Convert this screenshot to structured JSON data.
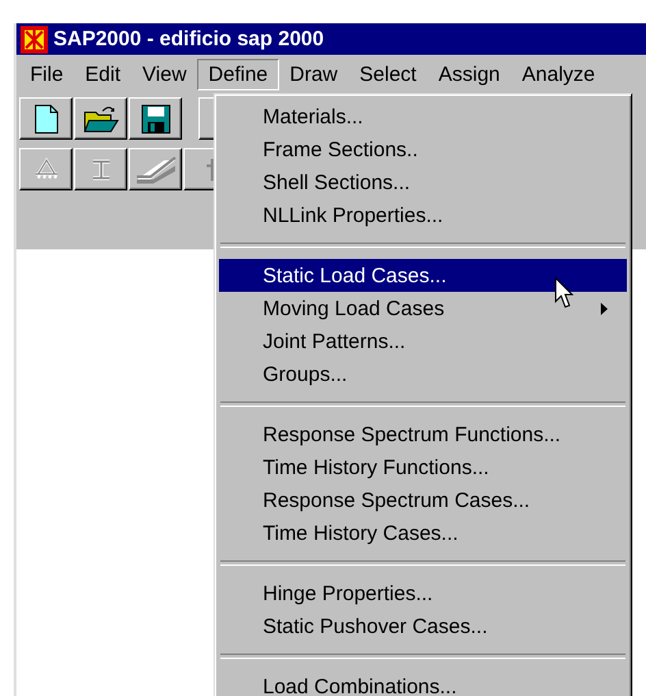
{
  "window": {
    "title": "SAP2000 - edificio sap 2000"
  },
  "menu_bar": [
    {
      "label": "File",
      "selected": false
    },
    {
      "label": "Edit",
      "selected": false
    },
    {
      "label": "View",
      "selected": false
    },
    {
      "label": "Define",
      "selected": true
    },
    {
      "label": "Draw",
      "selected": false
    },
    {
      "label": "Select",
      "selected": false
    },
    {
      "label": "Assign",
      "selected": false
    },
    {
      "label": "Analyze",
      "selected": false
    }
  ],
  "menu": {
    "groups": [
      [
        {
          "label": "Materials...",
          "selected": false,
          "submenu": false
        },
        {
          "label": "Frame Sections..",
          "selected": false,
          "submenu": false
        },
        {
          "label": "Shell Sections...",
          "selected": false,
          "submenu": false
        },
        {
          "label": "NLLink Properties...",
          "selected": false,
          "submenu": false
        }
      ],
      [
        {
          "label": "Static Load Cases...",
          "selected": true,
          "submenu": false
        },
        {
          "label": "Moving Load Cases",
          "selected": false,
          "submenu": true
        },
        {
          "label": "Joint Patterns...",
          "selected": false,
          "submenu": false
        },
        {
          "label": "Groups...",
          "selected": false,
          "submenu": false
        }
      ],
      [
        {
          "label": "Response Spectrum Functions...",
          "selected": false,
          "submenu": false
        },
        {
          "label": "Time History Functions...",
          "selected": false,
          "submenu": false
        },
        {
          "label": "Response Spectrum Cases...",
          "selected": false,
          "submenu": false
        },
        {
          "label": "Time History Cases...",
          "selected": false,
          "submenu": false
        }
      ],
      [
        {
          "label": "Hinge Properties...",
          "selected": false,
          "submenu": false
        },
        {
          "label": "Static Pushover Cases...",
          "selected": false,
          "submenu": false
        }
      ],
      [
        {
          "label": "Load Combinations...",
          "selected": false,
          "submenu": false
        }
      ]
    ]
  }
}
